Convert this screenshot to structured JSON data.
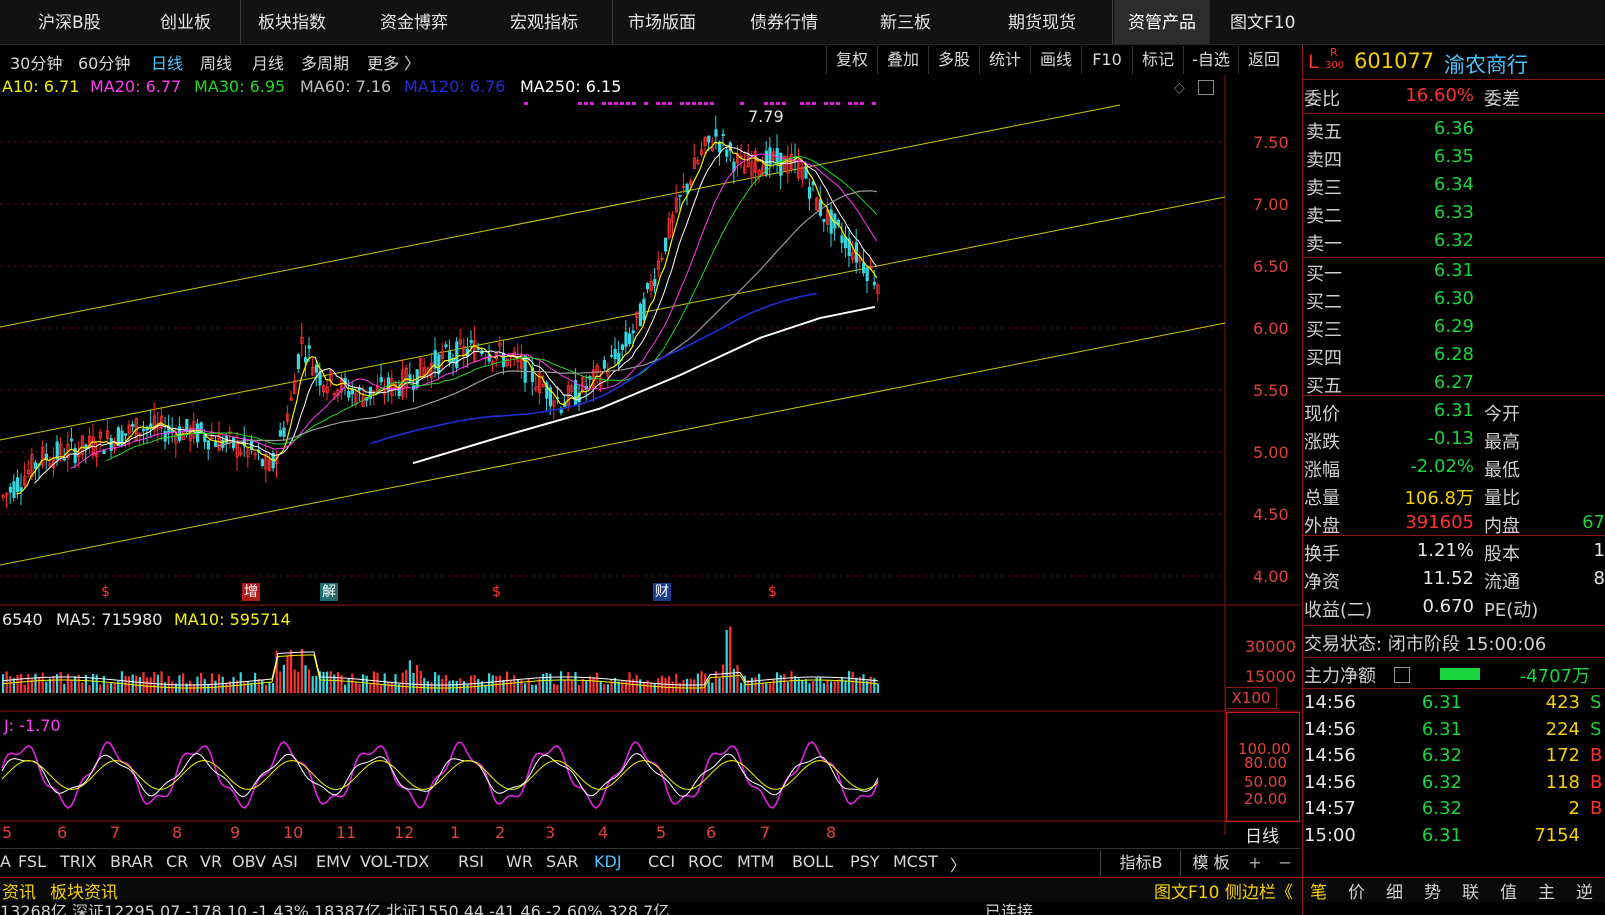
{
  "nav": {
    "items": [
      "沪深B股",
      "创业板",
      "板块指数",
      "资金博弈",
      "宏观指标",
      "市场版面",
      "债券行情",
      "新三板",
      "期货现货",
      "资管产品",
      "图文F10"
    ]
  },
  "periods": {
    "items": [
      "30分钟",
      "60分钟",
      "日线",
      "周线",
      "月线",
      "多周期",
      "更多 〉"
    ],
    "selected": "日线"
  },
  "toolbar": {
    "items": [
      "复权",
      "叠加",
      "多股",
      "统计",
      "画线",
      "F10",
      "标记",
      "-自选",
      "返回"
    ]
  },
  "ma_legend": {
    "ma10": "A10: 6.71",
    "ma20": "MA20: 6.77",
    "ma30": "MA30: 6.95",
    "ma60": "MA60: 7.16",
    "ma120": "MA120: 6.76",
    "ma250": "MA250: 6.15"
  },
  "colors": {
    "ma10": "#ffffff",
    "ma20": "#ff3bf5",
    "ma30": "#23d623",
    "ma60": "#c0c0c0",
    "ma120": "#1e2fd8",
    "ma250": "#ffffff",
    "up": "#ff3030",
    "down": "#34d6e0",
    "channel": "#c8c800",
    "axis": "#e0403a"
  },
  "price_axis": {
    "ticks": [
      "7.50",
      "7.00",
      "6.50",
      "6.00",
      "5.50",
      "5.00",
      "4.50",
      "4.00"
    ],
    "high_label": "7.79"
  },
  "events": [
    "$",
    "增",
    "解",
    "$",
    "财",
    "$"
  ],
  "volume": {
    "legend_vol": "6540",
    "legend_ma5": "MA5: 715980",
    "legend_ma10": "MA10: 595714",
    "ticks": [
      "30000",
      "15000"
    ],
    "unit": "X100"
  },
  "kdj": {
    "legend": "J: -1.70",
    "ticks": [
      "100.00",
      "80.00",
      "50.00",
      "20.00"
    ]
  },
  "months": [
    "5",
    "6",
    "7",
    "8",
    "9",
    "10",
    "11",
    "12",
    "1",
    "2",
    "3",
    "4",
    "5",
    "6",
    "7",
    "8"
  ],
  "period_badge": "日线",
  "indicators": {
    "items": [
      "A",
      "FSL",
      "TRIX",
      "BRAR",
      "CR",
      "VR",
      "OBV",
      "ASI",
      "EMV",
      "VOL-TDX",
      "RSI",
      "WR",
      "SAR",
      "KDJ",
      "CCI",
      "ROC",
      "MTM",
      "BOLL",
      "PSY",
      "MCST",
      "〉"
    ],
    "selected": "KDJ",
    "right": [
      "指标B",
      "模 板",
      "+",
      "−"
    ]
  },
  "info_bar": {
    "left1": "资讯",
    "left2": "板块资讯",
    "right": "图文F10 侧边栏《",
    "tabs": [
      "笔",
      "价",
      "细",
      "势",
      "联",
      "值",
      "主",
      "逆"
    ]
  },
  "status_bar": {
    "text": "13268亿 深证12295.07 -178.10 -1.43% 18387亿 北证1550.44 -41.46 -2.60% 328.7亿",
    "connection": "已连接"
  },
  "quote": {
    "prefix": "L",
    "badge_top": "R",
    "badge_bottom": "300",
    "code": "601077",
    "name": "渝农商行",
    "weibi_label": "委比",
    "weibi_value": "16.60%",
    "weicha_label": "委差",
    "sell": [
      {
        "label": "卖五",
        "price": "6.36"
      },
      {
        "label": "卖四",
        "price": "6.35"
      },
      {
        "label": "卖三",
        "price": "6.34"
      },
      {
        "label": "卖二",
        "price": "6.33"
      },
      {
        "label": "卖一",
        "price": "6.32"
      }
    ],
    "buy": [
      {
        "label": "买一",
        "price": "6.31"
      },
      {
        "label": "买二",
        "price": "6.30"
      },
      {
        "label": "买三",
        "price": "6.29"
      },
      {
        "label": "买四",
        "price": "6.28"
      },
      {
        "label": "买五",
        "price": "6.27"
      }
    ],
    "stats": [
      {
        "label": "现价",
        "value": "6.31",
        "label2": "今开",
        "value2": ""
      },
      {
        "label": "涨跌",
        "value": "-0.13",
        "label2": "最高",
        "value2": ""
      },
      {
        "label": "涨幅",
        "value": "-2.02%",
        "label2": "最低",
        "value2": ""
      },
      {
        "label": "总量",
        "value": "106.8万",
        "label2": "量比",
        "value2": ""
      },
      {
        "label": "外盘",
        "value": "391605",
        "label2": "内盘",
        "value2": "67"
      }
    ],
    "stats2": [
      {
        "label": "换手",
        "value": "1.21%",
        "label2": "股本",
        "value2": "1"
      },
      {
        "label": "净资",
        "value": "11.52",
        "label2": "流通",
        "value2": "8"
      },
      {
        "label": "收益(二)",
        "value": "0.670",
        "label2": "PE(动)",
        "value2": ""
      }
    ],
    "trade_status": "交易状态: 闭市阶段 15:00:06",
    "main_flow_label": "主力净额",
    "main_flow_value": "-4707万"
  },
  "ticks": [
    {
      "time": "14:56",
      "price": "6.31",
      "vol": "423",
      "side": "S"
    },
    {
      "time": "14:56",
      "price": "6.31",
      "vol": "224",
      "side": "S"
    },
    {
      "time": "14:56",
      "price": "6.32",
      "vol": "172",
      "side": "B"
    },
    {
      "time": "14:56",
      "price": "6.32",
      "vol": "118",
      "side": "B"
    },
    {
      "time": "14:57",
      "price": "6.32",
      "vol": "2",
      "side": "B"
    },
    {
      "time": "15:00",
      "price": "6.31",
      "vol": "7154",
      "side": ""
    }
  ]
}
